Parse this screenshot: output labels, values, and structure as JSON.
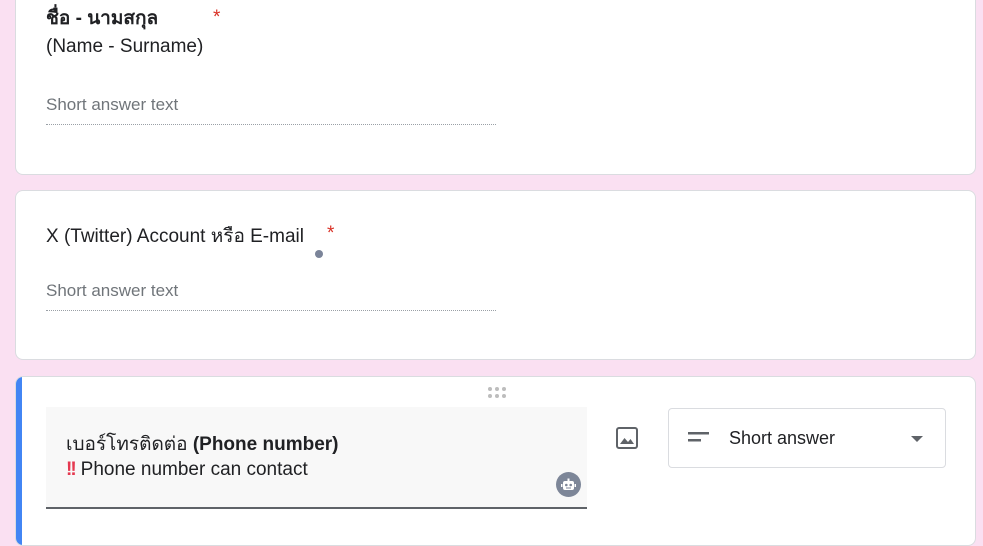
{
  "questions": [
    {
      "title_line1": "ชื่อ - นามสกุล",
      "title_line2": "(Name - Surname)",
      "required_mark": "*",
      "placeholder": "Short answer text"
    },
    {
      "title": "X (Twitter) Account หรือ E-mail",
      "required_mark": "*",
      "placeholder": "Short answer text"
    }
  ],
  "active_question": {
    "title_thai": "เบอร์โทรติดต่อ ",
    "title_bold": "(Phone number)",
    "description_emoji": "!!",
    "description": "Phone number can contact",
    "question_type": "Short answer",
    "icons": {
      "image": "image-icon",
      "type": "short-text-icon",
      "dropdown": "arrow-drop-down-icon",
      "assistant": "robot-icon",
      "drag": "drag-handle-icon"
    },
    "accent_color": "#4285f4"
  },
  "colors": {
    "background": "#fae0f2",
    "required": "#d93025",
    "accent": "#4285f4"
  }
}
